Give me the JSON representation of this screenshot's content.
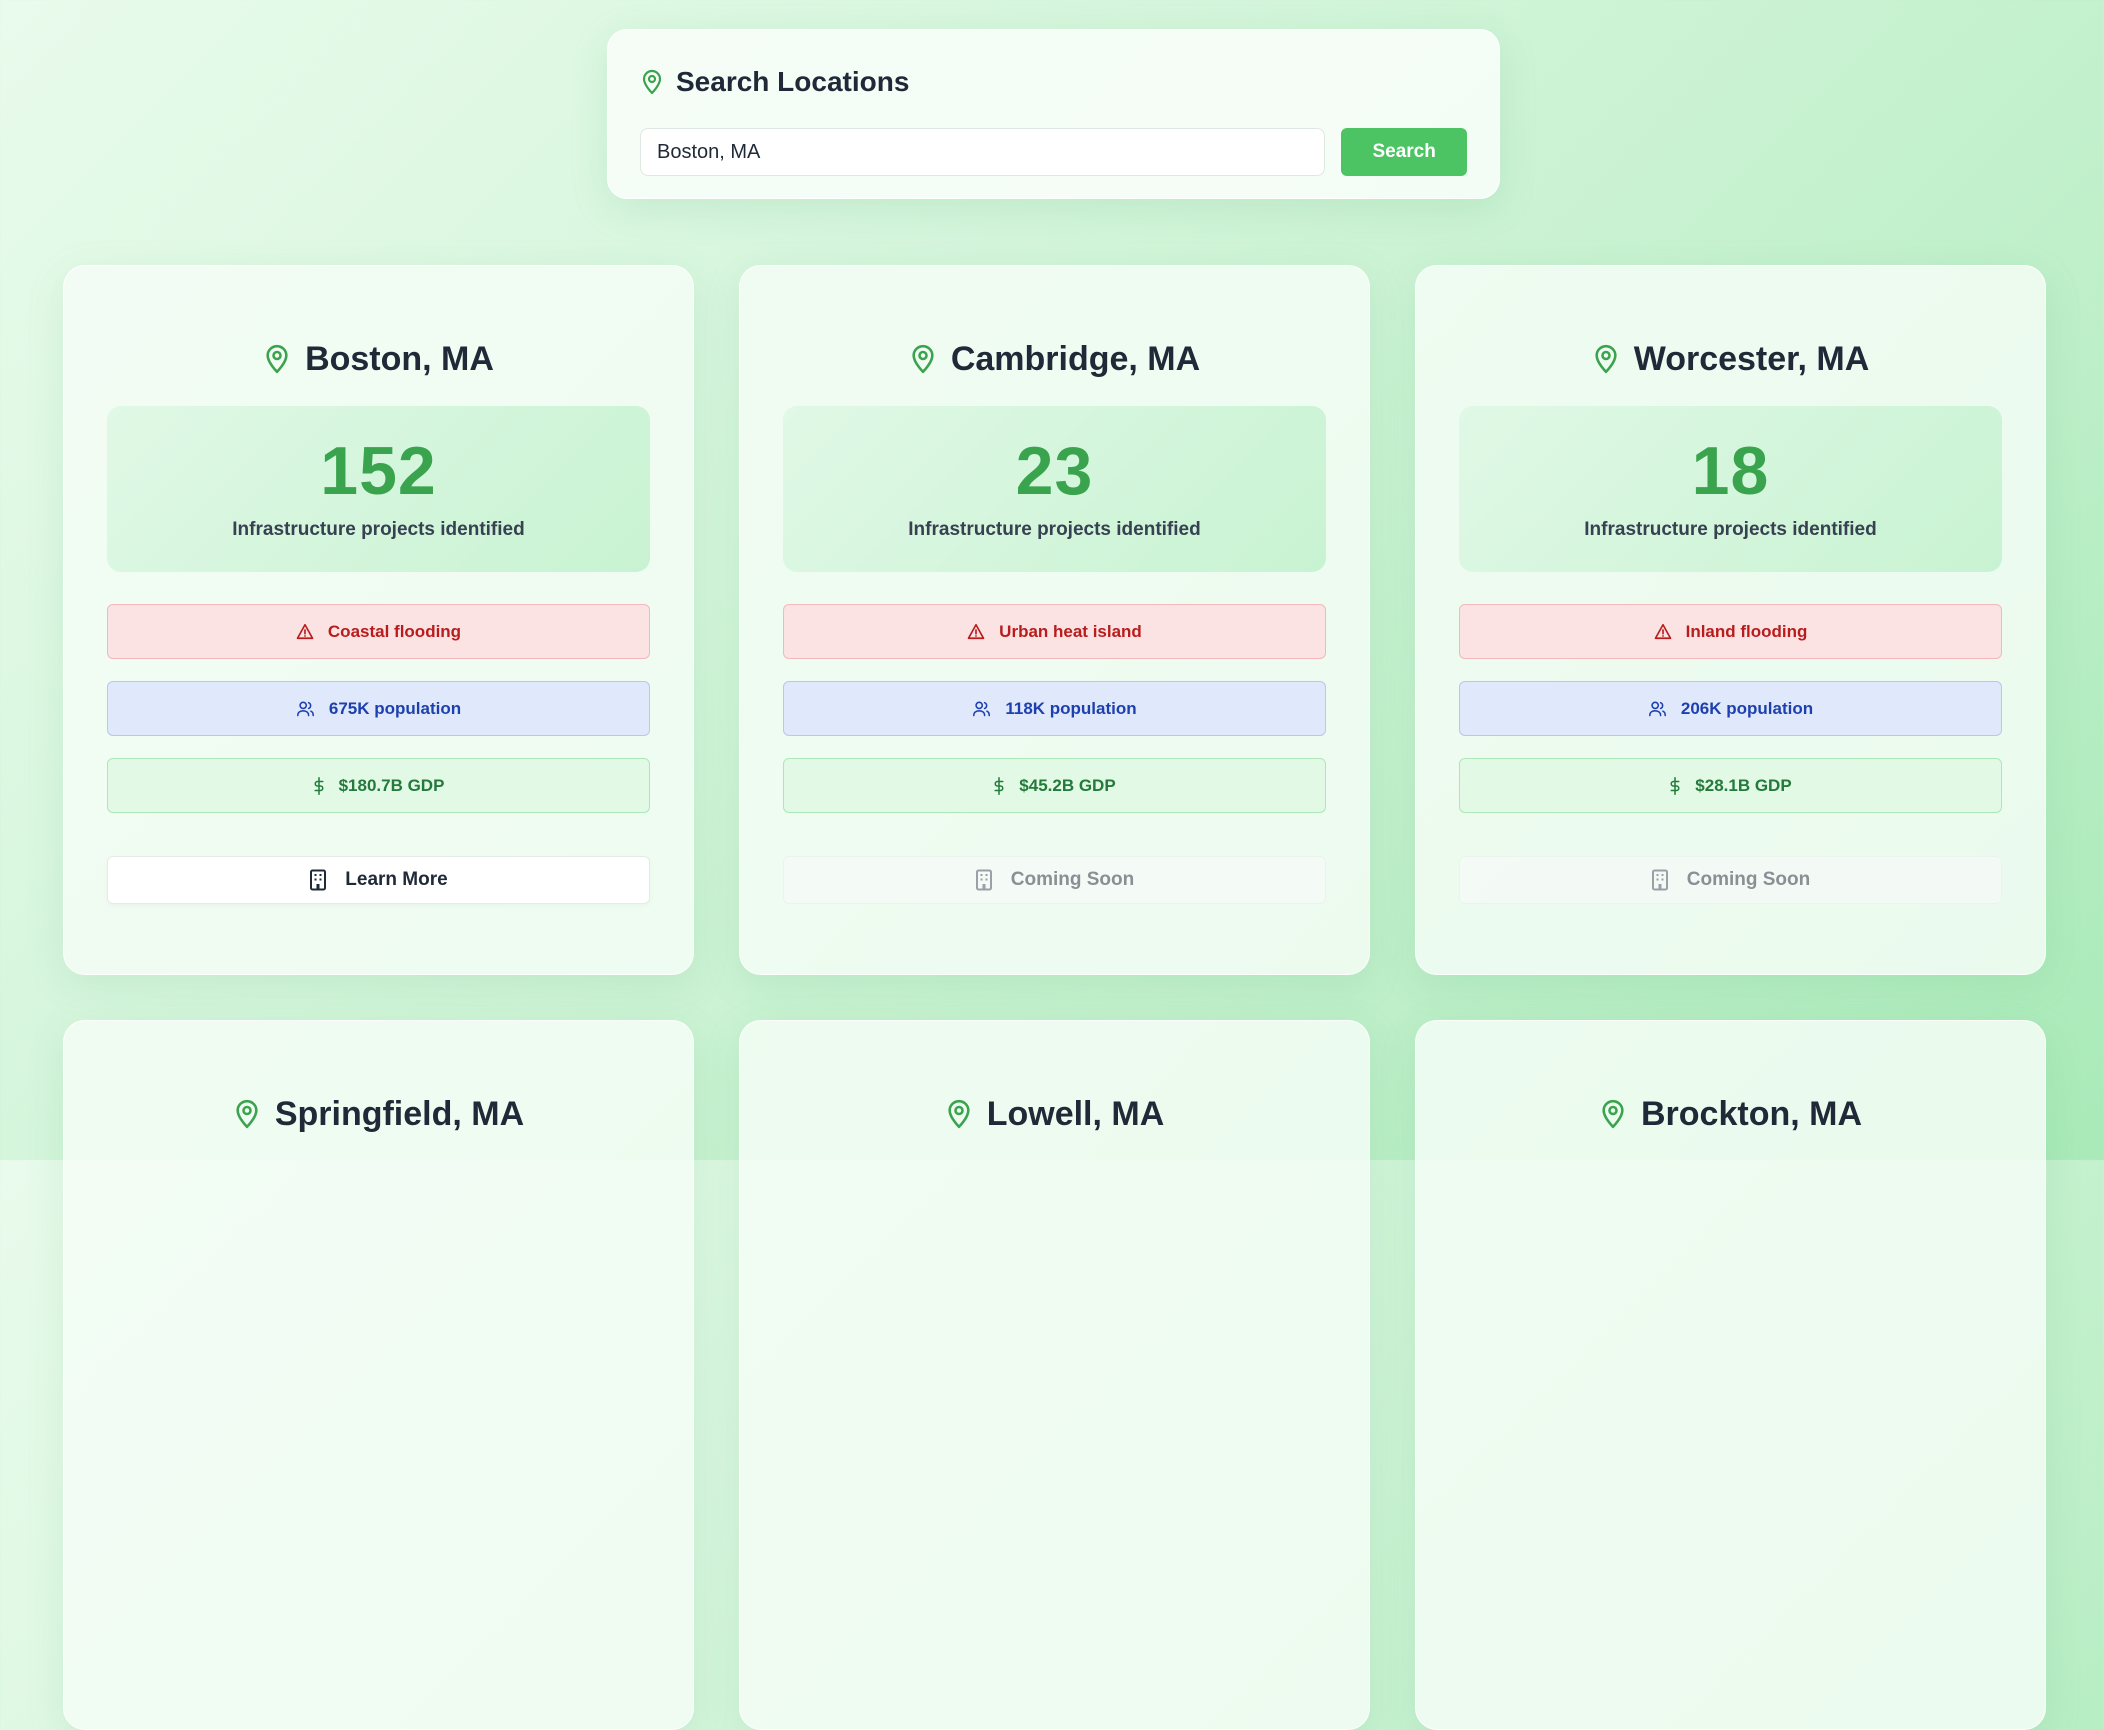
{
  "search": {
    "title": "Search Locations",
    "value": "Boston, MA",
    "button_label": "Search"
  },
  "colors": {
    "accent": "#4cc463",
    "count_green": "#3aa34e",
    "risk_red": "#b91c1c",
    "population_blue": "#1e40af",
    "gdp_green": "#237a3a"
  },
  "cards": [
    {
      "city": "Boston, MA",
      "count": "152",
      "count_label": "Infrastructure projects identified",
      "risk": "Coastal flooding",
      "population": "675K population",
      "gdp": "$180.7B GDP",
      "action": "Learn More",
      "action_enabled": true
    },
    {
      "city": "Cambridge, MA",
      "count": "23",
      "count_label": "Infrastructure projects identified",
      "risk": "Urban heat island",
      "population": "118K population",
      "gdp": "$45.2B GDP",
      "action": "Coming Soon",
      "action_enabled": false
    },
    {
      "city": "Worcester, MA",
      "count": "18",
      "count_label": "Infrastructure projects identified",
      "risk": "Inland flooding",
      "population": "206K population",
      "gdp": "$28.1B GDP",
      "action": "Coming Soon",
      "action_enabled": false
    },
    {
      "city": "Springfield, MA"
    },
    {
      "city": "Lowell, MA"
    },
    {
      "city": "Brockton, MA"
    }
  ],
  "icons": {
    "location": "map-pin-icon",
    "risk": "alert-triangle-icon",
    "population": "users-icon",
    "gdp": "dollar-icon",
    "action": "building-icon"
  }
}
